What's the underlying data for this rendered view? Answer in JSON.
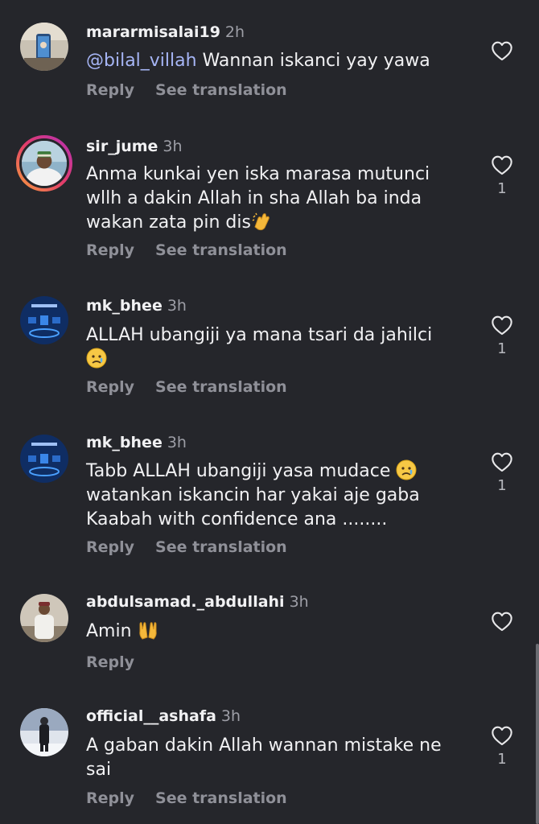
{
  "actions": {
    "reply_label": "Reply",
    "translate_label": "See translation"
  },
  "colors": {
    "background": "#25262b",
    "mention": "#a6b5f5",
    "muted": "#8f9098"
  },
  "comments": [
    {
      "username": "mararmisalai19",
      "time": "2h",
      "mention": "@bilal_villah",
      "text": " Wannan iskanci yay yawa",
      "likes": "",
      "has_translation": true
    },
    {
      "username": "sir_jume",
      "time": "3h",
      "text": "Anma kunkai yen iska marasa mutunci\nwllh a dakin Allah in sha Allah ba inda\nwakan zata pin dis",
      "emoji": "clapping-hands",
      "likes": "1",
      "has_translation": true
    },
    {
      "username": "mk_bhee",
      "time": "3h",
      "text": "ALLAH ubangiji ya mana tsari da jahilci\n",
      "emoji": "crying-face",
      "likes": "1",
      "has_translation": true
    },
    {
      "username": "mk_bhee",
      "time": "3h",
      "text_line1": "Tabb ALLAH ubangiji yasa mudace ",
      "emoji": "crying-face",
      "text_rest": "\nwatankan iskancin har yakai aje gaba\nKaabah with confidence ana ........",
      "likes": "1",
      "has_translation": true
    },
    {
      "username": "abdulsamad._abdullahi",
      "time": "3h",
      "text": "Amin ",
      "emoji": "open-hands",
      "likes": "",
      "has_translation": false
    },
    {
      "username": "official__ashafa",
      "time": "3h",
      "text": "A gaban dakin Allah wannan mistake ne\nsai",
      "likes": "1",
      "has_translation": true
    }
  ]
}
